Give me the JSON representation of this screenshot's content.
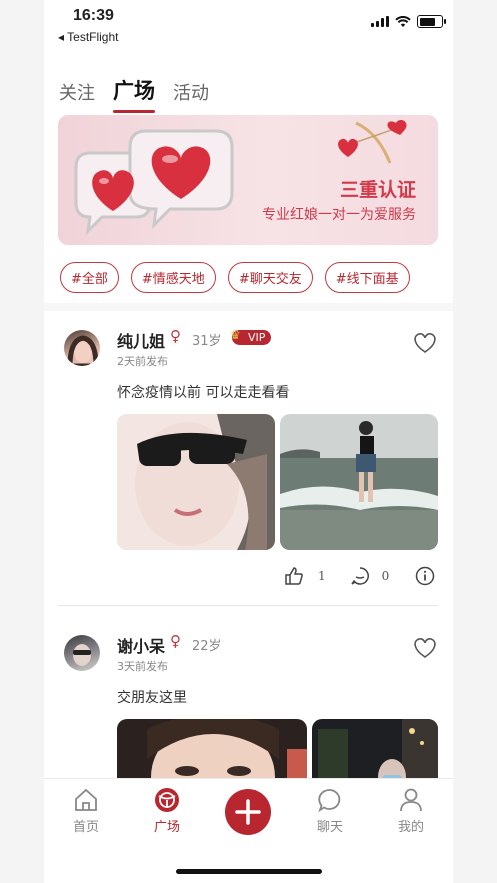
{
  "status_bar": {
    "time": "16:39",
    "back_app": "◂ TestFlight"
  },
  "top_tabs": [
    {
      "label": "关注",
      "active": false
    },
    {
      "label": "广场",
      "active": true
    },
    {
      "label": "活动",
      "active": false
    }
  ],
  "banner": {
    "title": "三重认证",
    "subtitle": "专业红娘一对一为爱服务"
  },
  "tags": [
    "#全部",
    "#情感天地",
    "#聊天交友",
    "#线下面基"
  ],
  "posts": [
    {
      "name": "纯儿姐",
      "age": "31岁",
      "vip": "VIP",
      "time": "2天前发布",
      "content": "怀念疫情以前 可以走走看看",
      "likes": "1",
      "comments": "0"
    },
    {
      "name": "谢小呆",
      "age": "22岁",
      "time": "3天前发布",
      "content": "交朋友这里"
    }
  ],
  "tabbar": [
    {
      "label": "首页",
      "icon": "home-icon"
    },
    {
      "label": "广场",
      "icon": "square-icon",
      "active": true
    },
    {
      "label": "",
      "icon": "plus-icon"
    },
    {
      "label": "聊天",
      "icon": "chat-icon"
    },
    {
      "label": "我的",
      "icon": "profile-icon"
    }
  ],
  "colors": {
    "accent": "#b8272f",
    "banner_bg": "#f3d9dd"
  }
}
